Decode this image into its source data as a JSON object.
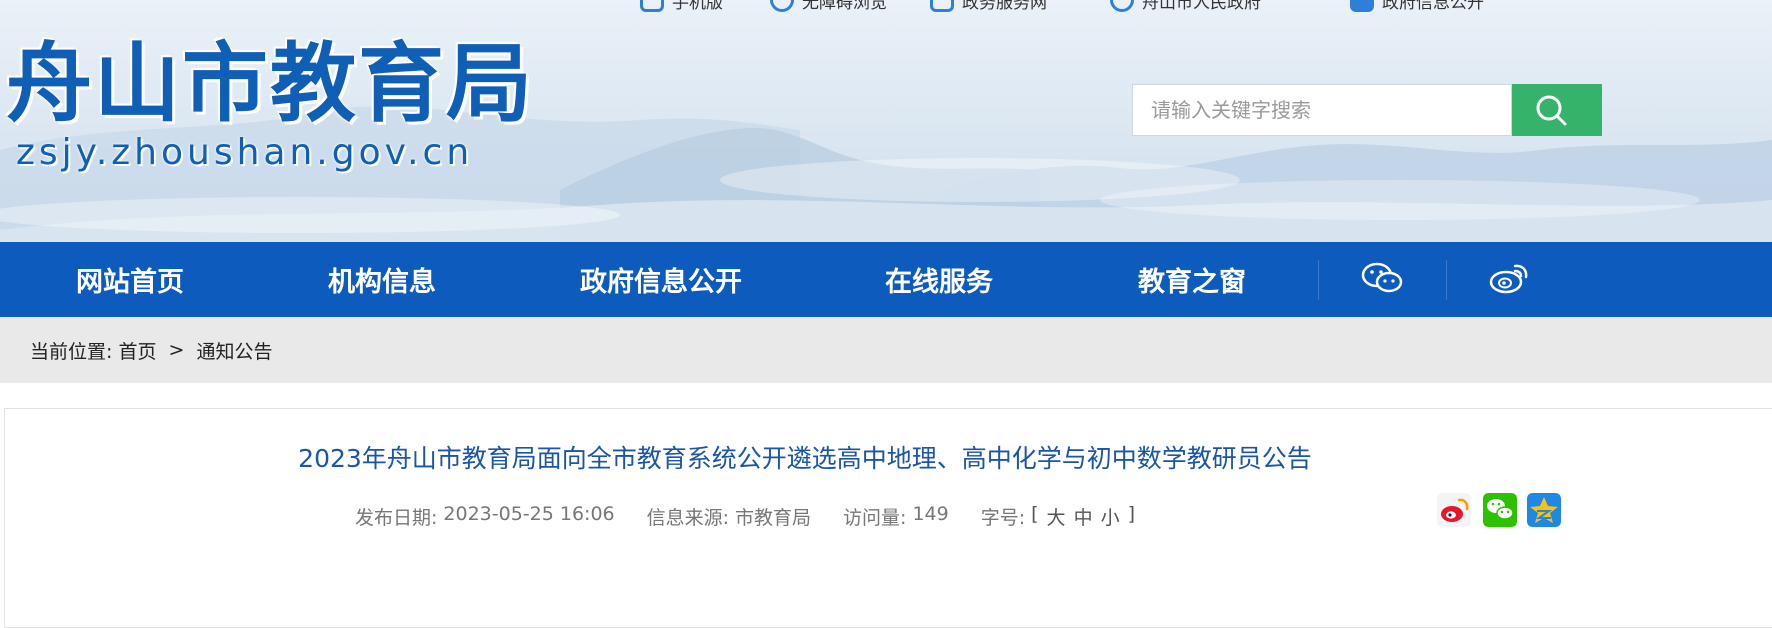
{
  "top_links": [
    {
      "label": "手机版",
      "icon": "mobile-icon"
    },
    {
      "label": "无障碍浏览",
      "icon": "accessibility-icon"
    },
    {
      "label": "政务服务网",
      "icon": "service-icon"
    },
    {
      "label": "舟山市人民政府",
      "icon": "government-icon"
    },
    {
      "label": "政府信息公开",
      "icon": "info-icon"
    }
  ],
  "logo": {
    "name": "舟山市教育局",
    "domain": "zsjy.zhoushan.gov.cn"
  },
  "search": {
    "placeholder": "请输入关键字搜索",
    "icon": "search-icon"
  },
  "nav": {
    "items": [
      "网站首页",
      "机构信息",
      "政府信息公开",
      "在线服务",
      "教育之窗"
    ],
    "social_icons": [
      "wechat-icon",
      "weibo-icon"
    ]
  },
  "breadcrumb": {
    "prefix": "当前位置: ",
    "home": "首页",
    "separator": "  >  ",
    "current": "通知公告"
  },
  "article": {
    "title": "2023年舟山市教育局面向全市教育系统公开遴选高中地理、高中化学与初中数学教研员公告",
    "date_label": "发布日期: ",
    "date": "2023-05-25 16:06",
    "source_label": "信息来源: ",
    "source": "市教育局",
    "views_label": "访问量: ",
    "views": "149",
    "font_label": "字号: ",
    "font_open": "[ ",
    "font_large": "大",
    "font_medium": "中",
    "font_small": "小",
    "font_close": " ]",
    "share_icons": [
      "weibo-share-icon",
      "wechat-share-icon",
      "qzone-share-icon"
    ]
  },
  "colors": {
    "nav_bg": "#0d5bbd",
    "brand_blue": "#0f5fb6",
    "search_btn": "#35b36a",
    "title_blue": "#1a55a8",
    "crumb_bg": "#e9e9e9"
  }
}
